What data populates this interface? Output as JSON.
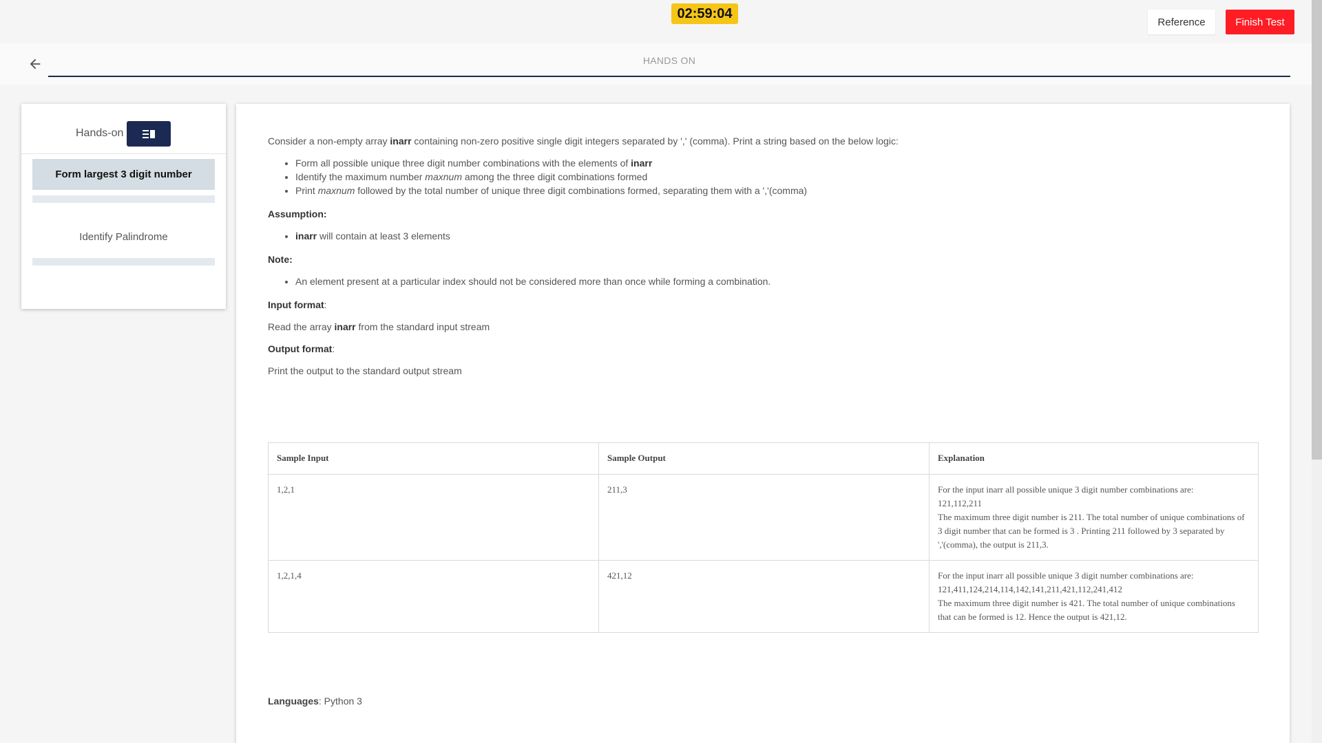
{
  "header": {
    "timer": "02:59:04",
    "reference_label": "Reference",
    "finish_label": "Finish Test",
    "section_title": "HANDS ON"
  },
  "sidebar": {
    "title": "Hands-on",
    "questions": [
      {
        "label": "Form largest 3 digit number",
        "active": true
      },
      {
        "label": "Identify Palindrome",
        "active": false
      }
    ]
  },
  "problem": {
    "intro_pre": "Consider a non-empty array ",
    "intro_var": "inarr",
    "intro_post": " containing non-zero positive single digit integers separated by ',' (comma). Print a string based on the below logic:",
    "bullet1_pre": "Form all possible unique three digit number combinations with the elements of ",
    "bullet1_var": "inarr",
    "bullet2_pre": "Identify the maximum number ",
    "bullet2_var": "maxnum",
    "bullet2_post": " among the three digit combinations formed",
    "bullet3_pre": "Print ",
    "bullet3_var": "maxnum",
    "bullet3_post": " followed by the total number of unique three digit combinations formed, separating them with a ','(comma)",
    "assumption_label": "Assumption:",
    "assumption_var": "inarr",
    "assumption_post": " will contain at least 3 elements",
    "note_label": "Note:",
    "note_text": "An element present at a particular index should not be considered more than once while forming a combination.",
    "input_label": "Input format",
    "input_pre": "Read the array ",
    "input_var": "inarr",
    "input_post": " from the standard input stream",
    "output_label": "Output format",
    "output_text": "Print the output to the standard output stream",
    "colon": ":"
  },
  "samples": {
    "headers": [
      "Sample Input",
      "Sample Output",
      "Explanation"
    ],
    "rows": [
      {
        "input": "1,2,1",
        "output": "211,3",
        "exp_line1": "For the input inarr all possible unique 3 digit number combinations are:",
        "exp_line2": "121,112,211",
        "exp_line3": "The maximum three digit number is 211. The total number of unique combinations of 3 digit number that can be formed is 3 . Printing 211 followed by 3 separated by ','(comma), the output is 211,3."
      },
      {
        "input": "1,2,1,4",
        "output": "421,12",
        "exp_line1": "For the input inarr all possible unique 3 digit number combinations are:",
        "exp_line2": "121,411,124,214,114,142,141,211,421,112,241,412",
        "exp_line3": "The maximum three digit number is 421. The total number of unique combinations that can be formed is 12. Hence the output is 421,12."
      }
    ]
  },
  "languages": {
    "label": "Languages",
    "value": ": Python 3"
  },
  "colors": {
    "timer_bg": "#f5c518",
    "finish_bg": "#ff1d25",
    "navy": "#1b2a52",
    "active_item_bg": "#d3dde3"
  },
  "icons": [
    "arrow-left-icon",
    "sidebar-toggle-icon"
  ]
}
